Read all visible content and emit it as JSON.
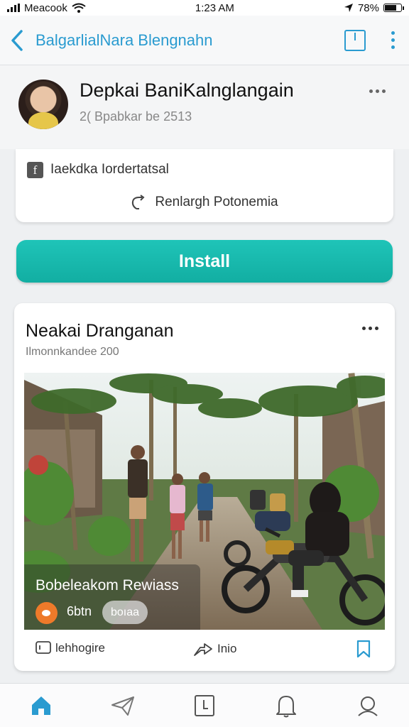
{
  "status_bar": {
    "carrier": "Meacook",
    "time": "1:23 AM",
    "battery_percent": "78%",
    "battery_level": 0.78
  },
  "app_bar": {
    "title": "BalgarlialNara Blengnahn",
    "icons": [
      "back-arrow-icon",
      "bookmark-icon",
      "more-vertical-icon"
    ],
    "accent_color": "#2a9bd0"
  },
  "profile": {
    "name": "Depkai BaniKalnglangain",
    "date": "2( Bpabkar be 2513",
    "icons": [
      "avatar",
      "more-horizontal-icon"
    ]
  },
  "info_card": {
    "label": "Iaekdka Iordertatsal",
    "share_label": "Renlargh Potonemia",
    "icons": [
      "facebook-icon",
      "share-icon"
    ]
  },
  "install": {
    "label": "Install",
    "color": "#1fc4b8"
  },
  "post": {
    "title": "Neakai Dranganan",
    "subtitle": "Ilmonnkandee 200",
    "overlay_title": "Bobeleakom Rewiass",
    "overlay_count": "6btn",
    "overlay_chip": "boıaa",
    "actions": {
      "left_label": "lehhogire",
      "middle_label": "Inio"
    },
    "icons": [
      "more-horizontal-icon",
      "play-icon",
      "comment-icon",
      "share-icon",
      "bookmark-icon"
    ]
  },
  "tab_bar": {
    "icons": [
      "home-icon",
      "send-icon",
      "square-icon",
      "bell-icon",
      "profile-icon"
    ],
    "active_color": "#2a9bd0"
  }
}
